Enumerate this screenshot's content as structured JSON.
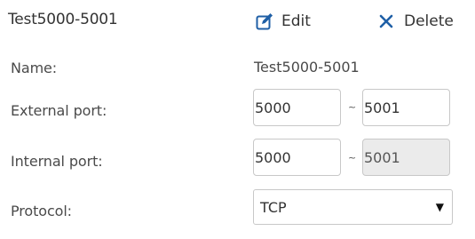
{
  "rule": {
    "title": "Test5000-5001",
    "edit_label": "Edit",
    "delete_label": "Delete"
  },
  "form": {
    "name_label": "Name:",
    "name_value": "Test5000-5001",
    "external_port_label": "External port:",
    "external_port_start": "5000",
    "external_port_end": "5001",
    "internal_port_label": "Internal port:",
    "internal_port_start": "5000",
    "internal_port_end": "5001",
    "range_separator": "~",
    "protocol_label": "Protocol:",
    "protocol_value": "TCP",
    "protocol_arrow": "▼"
  },
  "colors": {
    "icon_blue": "#1f5fa6",
    "disabled_bg": "#ebebeb",
    "border": "#c8c8c8"
  }
}
